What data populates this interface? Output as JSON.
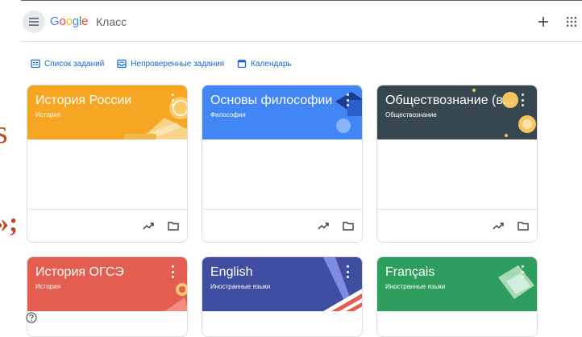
{
  "header": {
    "logo": [
      "G",
      "o",
      "o",
      "g",
      "l",
      "e"
    ],
    "product": "Класс"
  },
  "subnav": [
    {
      "label": "Список заданий",
      "icon": "assignment-list-icon"
    },
    {
      "label": "Непроверенные задания",
      "icon": "inbox-icon"
    },
    {
      "label": "Календарь",
      "icon": "calendar-icon"
    }
  ],
  "background_fragments": [
    "s",
    "»;"
  ],
  "cards": [
    {
      "title": "История России",
      "subtitle": "История",
      "color": "#f6a623"
    },
    {
      "title": "Основы философии",
      "subtitle": "Философия",
      "color": "#4285f4"
    },
    {
      "title": "Обществознание (в...",
      "subtitle": "Обществознание",
      "color": "#37474f"
    },
    {
      "title": "История ОГСЭ",
      "subtitle": "История",
      "color": "#e35d51"
    },
    {
      "title": "English",
      "subtitle": "Иностранные языки",
      "color": "#3f4ea0"
    },
    {
      "title": "Français",
      "subtitle": "Иностранные языки",
      "color": "#2e9e5e"
    }
  ],
  "colors": {
    "link": "#1967d2",
    "divider": "#dadce0",
    "icon": "#5f6368"
  }
}
